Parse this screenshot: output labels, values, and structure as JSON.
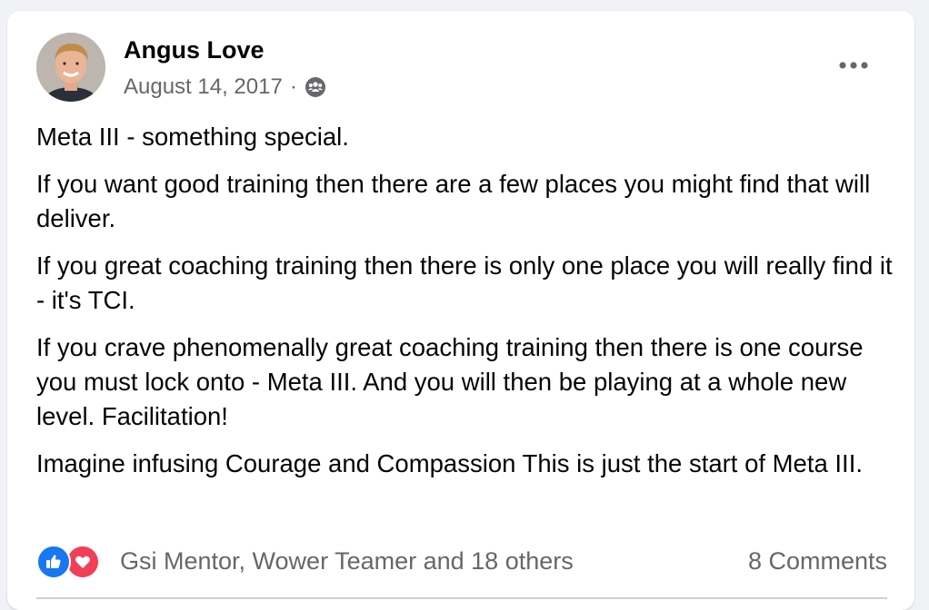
{
  "post": {
    "author": "Angus Love",
    "date": "August 14, 2017",
    "separator": "·",
    "audience_icon": "group-audience-icon",
    "more_icon": "more-horizontal-icon",
    "paragraphs": [
      "Meta III - something special.",
      "If you want good training then there are a few places you might find that will deliver.",
      "If you great coaching training then there is only one place you will really find it - it's TCI.",
      "If you crave phenomenally great coaching training then there is one course you must lock onto - Meta III. And you will then be playing at a whole new level. Facilitation!",
      "Imagine infusing Courage and Compassion This is just the start of Meta III."
    ]
  },
  "reactions": {
    "icons": [
      "like-reaction-icon",
      "love-reaction-icon"
    ],
    "text": "Gsi Mentor, Wower Teamer and 18 others",
    "comments": "8 Comments"
  },
  "colors": {
    "like": "#1877f2",
    "love": "#f33e58",
    "secondary_text": "#65676b",
    "background": "#f0f2f5"
  }
}
